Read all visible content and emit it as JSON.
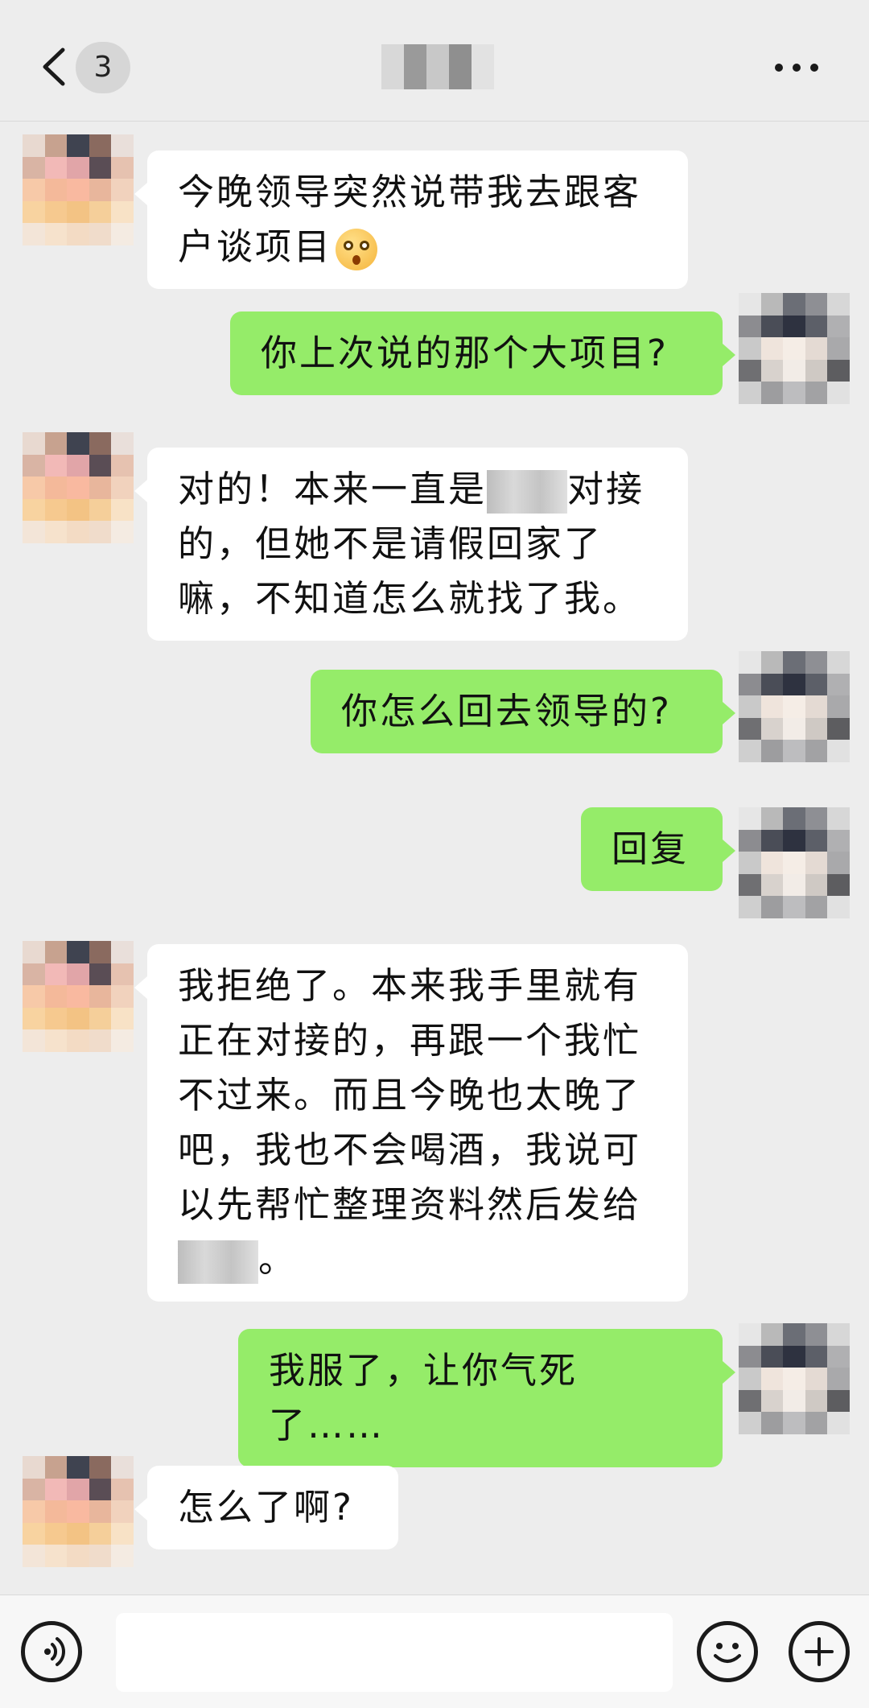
{
  "header": {
    "unread_count": "3",
    "title_mosaic_colors": [
      "#d8d8d8",
      "#9a9a9a",
      "#c8c8c8",
      "#8f8f8f",
      "#e2e2e2"
    ]
  },
  "messages": [
    {
      "side": "in",
      "text": "今晚领导突然说带我去跟客户谈项目",
      "emoji": "flushed-face"
    },
    {
      "side": "out",
      "text": "你上次说的那个大项目?"
    },
    {
      "side": "in",
      "text_before": "对的！本来一直是",
      "text_after": "对接的，但她不是请假回家了嘛，不知道怎么就找了我。"
    },
    {
      "side": "out",
      "text": "你怎么回去领导的?"
    },
    {
      "side": "out",
      "text": "回复"
    },
    {
      "side": "in",
      "text_before": "我拒绝了。本来我手里就有正在对接的，再跟一个我忙不过来。而且今晚也太晚了吧，我也不会喝酒，我说可以先帮忙整理资料然后发给",
      "text_after": "。"
    },
    {
      "side": "out",
      "text": "我服了，让你气死了……"
    },
    {
      "side": "in",
      "text": "怎么了啊?"
    }
  ],
  "avatars": {
    "contact_colors": [
      "#e8d9d0",
      "#c7a28f",
      "#3f4350",
      "#8a6a5f",
      "#e9dfda",
      "#d9b4a4",
      "#f2b9b7",
      "#e1a5a8",
      "#5a4d55",
      "#e6c2b0",
      "#f7c9a8",
      "#f4b99a",
      "#f9b9a0",
      "#e8b69c",
      "#f1d2bd",
      "#f8d3a0",
      "#f6c98f",
      "#f3c384",
      "#f5cf9a",
      "#f8e2c6",
      "#f3e5d8",
      "#f6e2cc",
      "#f3dbc4",
      "#f0dccb",
      "#f4ebe2"
    ],
    "self_colors": [
      "#e6e6e6",
      "#b9b9b9",
      "#6b6e76",
      "#8e8f94",
      "#d7d7d7",
      "#8c8c90",
      "#4a4d57",
      "#2e3240",
      "#5c5f68",
      "#b0b0b2",
      "#c9c9c9",
      "#efe4dc",
      "#f5ede6",
      "#e4dad3",
      "#a9a9ab",
      "#6f6f72",
      "#d8d2cd",
      "#f2ece7",
      "#cfc9c4",
      "#5d5d60",
      "#cfcfcf",
      "#9d9d9f",
      "#bdbdbf",
      "#a2a2a4",
      "#e1e1e1"
    ]
  },
  "input": {
    "placeholder": "",
    "value": ""
  },
  "colors": {
    "out_bubble": "#95EC69",
    "in_bubble": "#FFFFFF",
    "background": "#EDEDED"
  }
}
